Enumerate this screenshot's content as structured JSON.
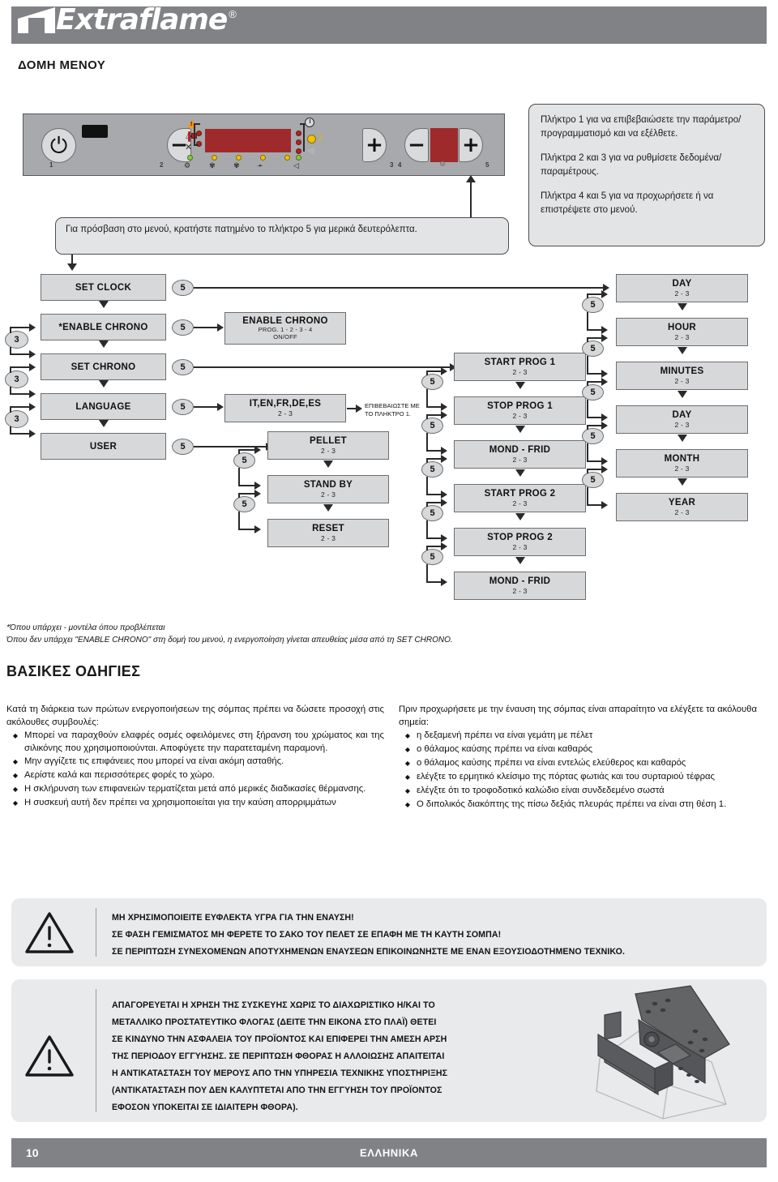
{
  "brand": {
    "name": "Extraflame",
    "registered": "®"
  },
  "page_title": "ΔΟΜΗ ΜΕΝΟΥ",
  "control_panel": {
    "key_numbers": [
      "1",
      "2",
      "3",
      "4",
      "5"
    ],
    "power_icon": "⏻",
    "minus_glyph": "−",
    "plus_glyph": "+"
  },
  "callouts": {
    "menu_access": "Για πρόσβαση στο μενού, κρατήστε πατημένο το πλήκτρο 5 για μερικά δευτερόλεπτα.",
    "keys_para1": "Πλήκτρο 1 για να επιβεβαιώσετε την παράμετρο/προγραμματισμό και να εξέλθετε.",
    "keys_para2": "Πλήκτρα 2 και 3 για να ρυθμίσετε δεδομένα/παραμέτρους.",
    "keys_para3": "Πλήκτρα 4 και 5 για να προχωρήσετε ή να επιστρέψετε στο μενού."
  },
  "flow": {
    "bubble_5": "5",
    "bubble_3": "3",
    "confirm_note": "ΕΠΙΒΕΒΑΙΩΣΤΕ ΜΕ ΤΟ ΠΛΗΚΤΡΟ 1.",
    "col1": [
      {
        "label": "SET CLOCK",
        "sub": ""
      },
      {
        "label": "*ENABLE CHRONO",
        "sub": ""
      },
      {
        "label": "SET CHRONO",
        "sub": ""
      },
      {
        "label": "LANGUAGE",
        "sub": ""
      },
      {
        "label": "USER",
        "sub": ""
      }
    ],
    "col2": [
      {
        "label": "ENABLE CHRONO",
        "sub": "PROG. 1 - 2 - 3 - 4",
        "sub2": "ON/OFF"
      },
      {
        "label": "IT,EN,FR,DE,ES",
        "sub": "2 - 3"
      },
      {
        "label": "PELLET",
        "sub": "2 - 3"
      },
      {
        "label": "STAND BY",
        "sub": "2 - 3"
      },
      {
        "label": "RESET",
        "sub": "2 - 3"
      }
    ],
    "col3": [
      {
        "label": "START PROG 1",
        "sub": "2 - 3"
      },
      {
        "label": "STOP PROG 1",
        "sub": "2 - 3"
      },
      {
        "label": "MOND - FRID",
        "sub": "2 - 3"
      },
      {
        "label": "START PROG 2",
        "sub": "2 - 3"
      },
      {
        "label": "STOP PROG 2",
        "sub": "2 - 3"
      },
      {
        "label": "MOND - FRID",
        "sub": "2 - 3"
      }
    ],
    "col4": [
      {
        "label": "DAY",
        "sub": "2 - 3"
      },
      {
        "label": "HOUR",
        "sub": "2 - 3"
      },
      {
        "label": "MINUTES",
        "sub": "2 - 3"
      },
      {
        "label": "DAY",
        "sub": "2 - 3"
      },
      {
        "label": "MONTH",
        "sub": "2 - 3"
      },
      {
        "label": "YEAR",
        "sub": "2 - 3"
      }
    ]
  },
  "footnote": {
    "line1": "*Όπου υπάρχει - μοντέλα όπου προβλέπεται",
    "line2": "Όπου δεν υπάρχει \"ENABLE CHRONO\" στη δομή του μενού, η ενεργοποίηση γίνεται απευθείας μέσα από τη SET CHRONO."
  },
  "section_title": "ΒΑΣΙΚΕΣ ΟΔΗΓΙΕΣ",
  "left_column": {
    "intro": "Κατά τη διάρκεια των πρώτων ενεργοποιήσεων της σόμπας πρέπει να δώσετε προσοχή στις ακόλουθες συμβουλές:",
    "bullets": [
      "Μπορεί να παραχθούν ελαφρές οσμές οφειλόμενες στη ξήρανση του χρώματος και της σιλικόνης που χρησιμοποιούνται. Αποφύγετε την παρατεταμένη παραμονή.",
      "Μην αγγίζετε τις επιφάνειες που μπορεί να είναι ακόμη ασταθής.",
      "Αερίστε καλά και περισσότερες φορές το χώρο.",
      "Η σκλήρυνση των επιφανειών τερματίζεται μετά από μερικές διαδικασίες θέρμανσης.",
      "Η συσκευή αυτή δεν πρέπει να χρησιμοποιείται για την καύση απορριμμάτων"
    ]
  },
  "right_column": {
    "intro": "Πριν προχωρήσετε με την έναυση της σόμπας είναι απαραίτητο να ελέγξετε τα ακόλουθα σημεία:",
    "bullets": [
      "η δεξαμενή πρέπει να είναι γεμάτη με πέλετ",
      "ο θάλαμος καύσης πρέπει να είναι καθαρός",
      "ο θάλαμος καύσης πρέπει να είναι εντελώς ελεύθερος και καθαρός",
      "ελέγξτε το ερμητικό κλείσιμο της πόρτας φωτιάς και του συρταριού τέφρας",
      "ελέγξτε ότι το τροφοδοτικό καλώδιο είναι συνδεδεμένο σωστά",
      "Ο διπολικός διακόπτης της πίσω δεξιάς πλευράς πρέπει να είναι στη θέση 1."
    ]
  },
  "warning1": {
    "lines": [
      "ΜΗ ΧΡΗΣΙΜΟΠΟΙΕΙΤΕ ΕΥΦΛΕΚΤΑ ΥΓΡΑ ΓΙΑ ΤΗΝ ΕΝΑΥΣΗ!",
      "ΣΕ ΦΑΣΗ ΓΕΜΙΣΜΑΤΟΣ ΜΗ ΦΕΡΕΤΕ ΤΟ ΣΑΚΟ ΤΟΥ ΠΕΛΕΤ ΣΕ ΕΠΑΦΗ ΜΕ ΤΗ ΚΑΥΤΗ ΣΟΜΠΑ!",
      "ΣΕ ΠΕΡΙΠΤΩΣΗ ΣΥΝΕΧΟΜΕΝΩΝ ΑΠΟΤΥΧΗΜΕΝΩΝ ΕΝΑΥΣΕΩΝ ΕΠΙΚΟΙΝΩΝΗΣΤΕ ΜΕ ΕΝΑΝ ΕΞΟΥΣΙΟΔΟΤΗΜΕΝΟ ΤΕΧΝΙΚΟ."
    ]
  },
  "warning2": {
    "lines": [
      "ΑΠΑΓΟΡΕΥΕΤΑΙ Η ΧΡΗΣΗ ΤΗΣ ΣΥΣΚΕΥΗΣ ΧΩΡΙΣ ΤΟ ΔΙΑΧΩΡΙΣΤΙΚΟ Η/ΚΑΙ ΤΟ",
      "ΜΕΤΑΛΛΙΚΟ ΠΡΟΣΤΑΤΕΥΤΙΚΟ ΦΛΟΓΑΣ (ΔΕΙΤΕ ΤΗΝ ΕΙΚΟΝΑ ΣΤΟ ΠΛΑΪ) ΘΕΤΕΙ",
      "ΣΕ ΚΙΝΔΥΝΟ ΤΗΝ ΑΣΦΑΛΕΙΑ ΤΟΥ ΠΡΟΪΟΝΤΟΣ ΚΑΙ ΕΠΙΦΕΡΕΙ ΤΗΝ ΑΜΕΣΗ ΑΡΣΗ",
      "ΤΗΣ ΠΕΡΙΟΔΟΥ ΕΓΓΥΗΣΗΣ. ΣΕ ΠΕΡΙΠΤΩΣΗ ΦΘΟΡΑΣ Η ΑΛΛΟΙΩΣΗΣ ΑΠΑΙΤΕΙΤΑΙ",
      "Η ΑΝΤΙΚΑΤΑΣΤΑΣΗ ΤΟΥ ΜΕΡΟΥΣ ΑΠΟ ΤΗΝ ΥΠΗΡΕΣΙΑ ΤΕΧΝΙΚΗΣ ΥΠΟΣΤΗΡΙΞΗΣ",
      "(ΑΝΤΙΚΑΤΑΣΤΑΣΗ ΠΟΥ ΔΕΝ ΚΑΛΥΠΤΕΤΑΙ ΑΠΟ ΤΗΝ ΕΓΓΥΗΣΗ ΤΟΥ ΠΡΟΪΟΝΤΟΣ",
      "ΕΦΟΣΟΝ ΥΠΟΚΕΙΤΑΙ ΣΕ ΙΔΙΑΙΤΕΡΗ ΦΘΟΡΑ)."
    ]
  },
  "footer": {
    "page_number": "10",
    "language": "ΕΛΛΗΝΙΚΑ"
  },
  "colors": {
    "brand_gray": "#808285",
    "box_fill": "#d7d8da",
    "panel_fill": "#a7a9ac",
    "display_red": "#9e2a2b",
    "warn_bg": "#e9eaec"
  }
}
